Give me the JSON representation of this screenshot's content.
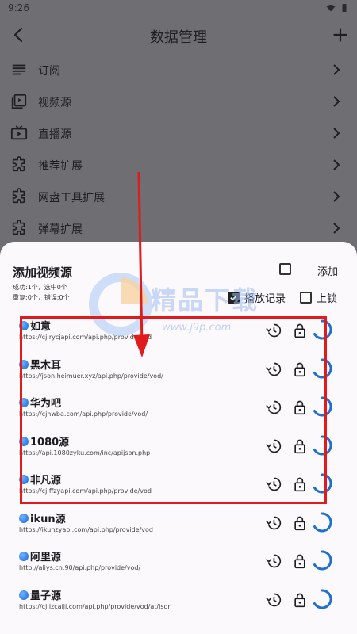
{
  "status_bar": {
    "time": "9:26"
  },
  "app_bar": {
    "title": "数据管理"
  },
  "menu": [
    {
      "label": "订阅",
      "icon": "list-icon"
    },
    {
      "label": "视频源",
      "icon": "video-library-icon"
    },
    {
      "label": "直播源",
      "icon": "live-tv-icon"
    },
    {
      "label": "推荐扩展",
      "icon": "extension-icon"
    },
    {
      "label": "网盘工具扩展",
      "icon": "extension-icon"
    },
    {
      "label": "弹幕扩展",
      "icon": "extension-icon"
    }
  ],
  "sheet": {
    "title": "添加视频源",
    "stats_line1": "成功:1个，选中0个",
    "stats_line2": "重复:0个，错误:0个",
    "add_label": "添加",
    "play_history_label": "播放记录",
    "play_history_checked": true,
    "lock_label": "上锁",
    "lock_checked": false,
    "sources": [
      {
        "name": "如意",
        "url": "https://cj.rycjapi.com/api.php/provide/vod"
      },
      {
        "name": "黑木耳",
        "url": "https://json.heimuer.xyz/api.php/provide/vod/"
      },
      {
        "name": "华为吧",
        "url": "https://cjhwba.com/api.php/provide/vod/"
      },
      {
        "name": "1080源",
        "url": "https://api.1080zyku.com/inc/apijson.php"
      },
      {
        "name": "非凡源",
        "url": "https://cj.ffzyapi.com/api.php/provide/vod"
      },
      {
        "name": "ikun源",
        "url": "https://ikunzyapi.com/api.php/provide/vod"
      },
      {
        "name": "阿里源",
        "url": "http://aliys.cn:90/api.php/provide/vod/"
      },
      {
        "name": "量子源",
        "url": "https://cj.lzcaiji.com/api.php/provide/vod/at/json"
      }
    ]
  },
  "watermark": {
    "text": "精品下载",
    "url": "www.j9p.com"
  },
  "colors": {
    "accent_blue": "#1f6fd0",
    "annotation_red": "#e01b1b",
    "scrim": "#6f6e72",
    "sheet_bg": "#fcf9fd"
  }
}
